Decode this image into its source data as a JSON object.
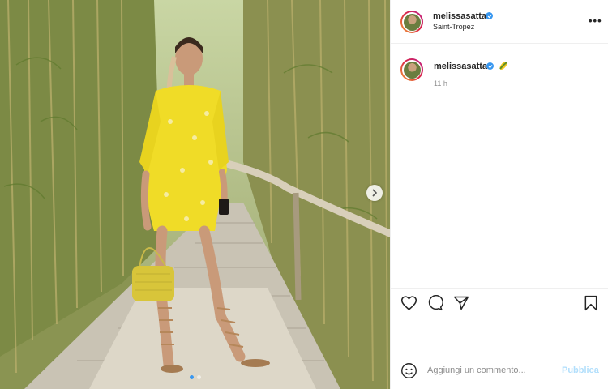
{
  "post": {
    "username": "melissasatta",
    "location": "Saint-Tropez",
    "caption_username": "melissasatta",
    "caption_emoji": "corn-emoji",
    "time": "11 h"
  },
  "carousel": {
    "slides": 2,
    "active": 0
  },
  "icons": {
    "more": "more-options-icon",
    "like": "heart-icon",
    "comment": "comment-icon",
    "share": "paper-plane-icon",
    "save": "bookmark-icon",
    "emoji": "smiley-icon",
    "next": "chevron-right-icon",
    "verified": "verified-badge-icon"
  },
  "comment": {
    "placeholder": "Aggiungi un commento...",
    "publish_label": "Pubblica"
  },
  "colors": {
    "accent": "#3897f0",
    "publish_disabled": "#b2dffc"
  },
  "ui": {
    "more_glyph": "•••"
  }
}
